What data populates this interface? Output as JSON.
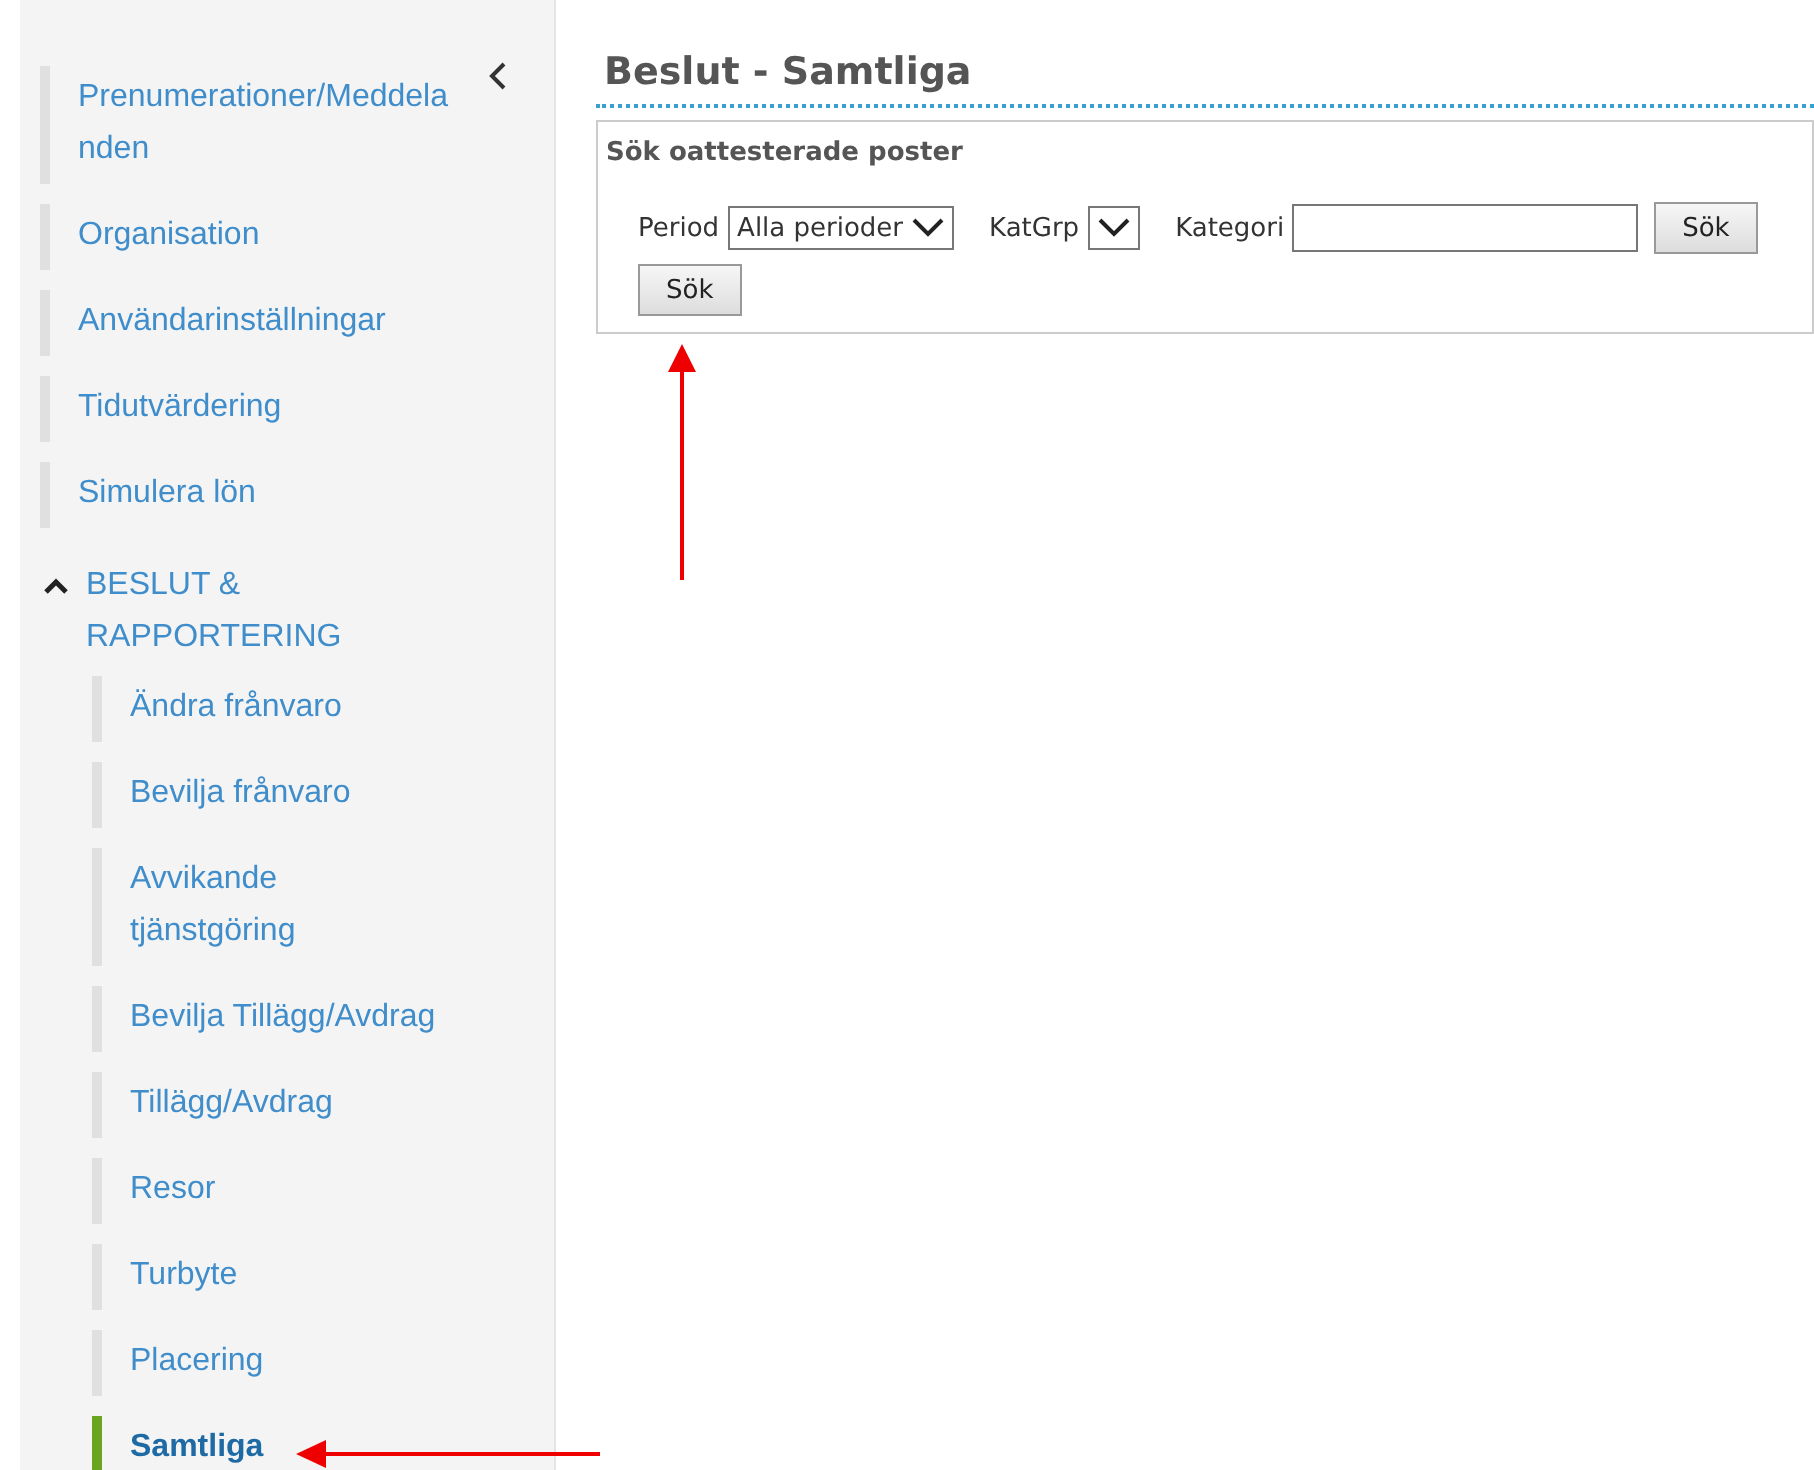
{
  "sidebar": {
    "items": [
      {
        "label": "Prenumerationer/Meddelanden",
        "selected": false
      },
      {
        "label": "Organisation",
        "selected": false
      },
      {
        "label": "Användarinställningar",
        "selected": false
      },
      {
        "label": "Tidutvärdering",
        "selected": false
      },
      {
        "label": "Simulera lön",
        "selected": false
      },
      {
        "label": "BESLUT & RAPPORTERING",
        "expanded": true,
        "children": [
          {
            "label": "Ändra frånvaro",
            "selected": false
          },
          {
            "label": "Bevilja frånvaro",
            "selected": false
          },
          {
            "label": "Avvikande tjänstgöring",
            "selected": false
          },
          {
            "label": "Bevilja Tillägg/Avdrag",
            "selected": false
          },
          {
            "label": "Tillägg/Avdrag",
            "selected": false
          },
          {
            "label": "Resor",
            "selected": false
          },
          {
            "label": "Turbyte",
            "selected": false
          },
          {
            "label": "Placering",
            "selected": false
          },
          {
            "label": "Samtliga",
            "selected": true
          }
        ]
      }
    ]
  },
  "page_title": "Beslut - Samtliga",
  "search_panel": {
    "title": "Sök oattesterade poster",
    "fields": [
      {
        "kind": "select",
        "label": "Period",
        "value": "Alla perioder"
      },
      {
        "kind": "select",
        "label": "KatGrp"
      },
      {
        "kind": "input",
        "label": "Kategori"
      },
      {
        "kind": "button",
        "label": "Sök"
      }
    ],
    "button": "Sök"
  }
}
